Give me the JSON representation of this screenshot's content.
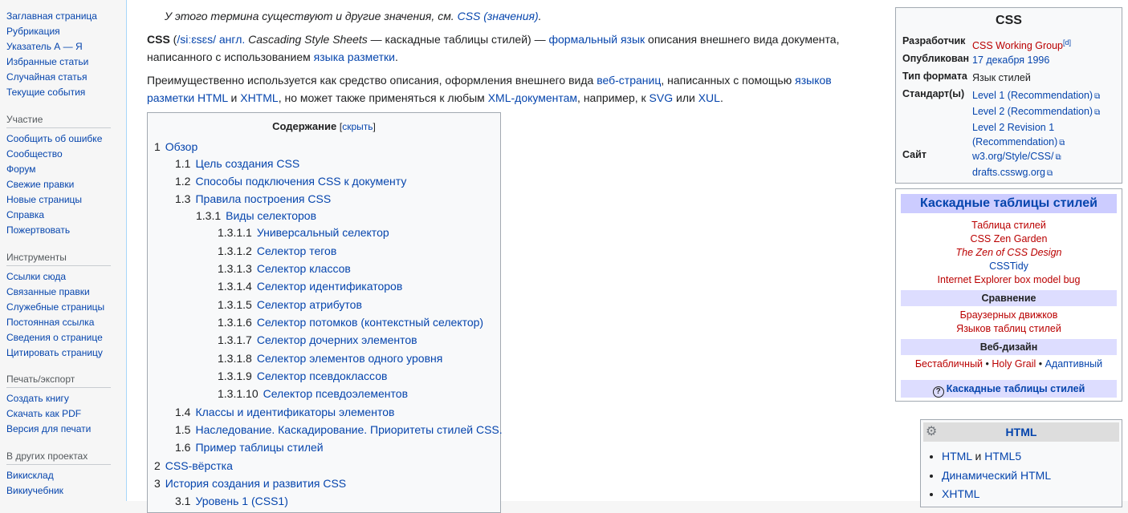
{
  "sidebar": {
    "main": [
      "Заглавная страница",
      "Рубрикация",
      "Указатель А — Я",
      "Избранные статьи",
      "Случайная статья",
      "Текущие события"
    ],
    "participation": {
      "heading": "Участие",
      "items": [
        "Сообщить об ошибке",
        "Сообщество",
        "Форум",
        "Свежие правки",
        "Новые страницы",
        "Справка",
        "Пожертвовать"
      ]
    },
    "tools": {
      "heading": "Инструменты",
      "items": [
        "Ссылки сюда",
        "Связанные правки",
        "Служебные страницы",
        "Постоянная ссылка",
        "Сведения о странице",
        "Цитировать страницу"
      ]
    },
    "print": {
      "heading": "Печать/экспорт",
      "items": [
        "Создать книгу",
        "Скачать как PDF",
        "Версия для печати"
      ]
    },
    "other": {
      "heading": "В других проектах",
      "items": [
        "Викисклад",
        "Викиучебник"
      ]
    }
  },
  "hatnote": {
    "text": "У этого термина существуют и другие значения, см. ",
    "link": "CSS (значения)",
    "end": "."
  },
  "lead1": {
    "bold": "CSS",
    "ipa": "/siːɛsɛs/",
    "lang": "англ.",
    "term": "Cascading Style Sheets",
    "dash": " — каскадные таблицы стилей) — ",
    "link1": "формальный язык",
    "mid": " описания внешнего вида документа, написанного с использованием ",
    "link2": "языка разметки",
    "end": "."
  },
  "lead2": {
    "t1": "Преимущественно используется как средство описания, оформления внешнего вида ",
    "l1": "веб-страниц",
    "t2": ", написанных с помощью ",
    "l2": "языков разметки HTML",
    "t3": " и ",
    "l3": "XHTML",
    "t4": ", но может также применяться к любым ",
    "l4": "XML-документам",
    "t5": ", например, к ",
    "l5": "SVG",
    "t6": " или ",
    "l6": "XUL",
    "t7": "."
  },
  "toc": {
    "title": "Содержание",
    "toggle_open": "[",
    "toggle_label": "скрыть",
    "toggle_close": "]",
    "items": [
      {
        "num": "1",
        "text": "Обзор"
      },
      {
        "num": "1.1",
        "text": "Цель создания CSS"
      },
      {
        "num": "1.2",
        "text": "Способы подключения CSS к документу"
      },
      {
        "num": "1.3",
        "text": "Правила построения CSS"
      },
      {
        "num": "1.3.1",
        "text": "Виды селекторов"
      },
      {
        "num": "1.3.1.1",
        "text": "Универсальный селектор"
      },
      {
        "num": "1.3.1.2",
        "text": "Селектор тегов"
      },
      {
        "num": "1.3.1.3",
        "text": "Селектор классов"
      },
      {
        "num": "1.3.1.4",
        "text": "Селектор идентификаторов"
      },
      {
        "num": "1.3.1.5",
        "text": "Селектор атрибутов"
      },
      {
        "num": "1.3.1.6",
        "text": "Селектор потомков (контекстный селектор)"
      },
      {
        "num": "1.3.1.7",
        "text": "Селектор дочерних элементов"
      },
      {
        "num": "1.3.1.8",
        "text": "Селектор элементов одного уровня"
      },
      {
        "num": "1.3.1.9",
        "text": "Селектор псевдоклассов"
      },
      {
        "num": "1.3.1.10",
        "text": "Селектор псевдоэлементов"
      },
      {
        "num": "1.4",
        "text": "Классы и идентификаторы элементов"
      },
      {
        "num": "1.5",
        "text": "Наследование. Каскадирование. Приоритеты стилей CSS."
      },
      {
        "num": "1.6",
        "text": "Пример таблицы стилей"
      },
      {
        "num": "2",
        "text": "CSS-вёрстка"
      },
      {
        "num": "3",
        "text": "История создания и развития CSS"
      },
      {
        "num": "3.1",
        "text": "Уровень 1 (CSS1)"
      }
    ]
  },
  "infobox": {
    "title": "CSS",
    "developer_label": "Разработчик",
    "developer": "CSS Working Group",
    "developer_sup": "[d]",
    "published_label": "Опубликован",
    "published": "17 декабря 1996",
    "format_label": "Тип формата",
    "format": "Язык стилей",
    "standard_label": "Стандарт(ы)",
    "standard1": "Level 1 (Recommendation)",
    "standard2": "Level 2 (Recommendation)",
    "standard3a": "Level 2 Revision 1",
    "standard3b": "(Recommendation)",
    "site_label": "Сайт",
    "site1": "w3.org/Style/CSS/",
    "site2": "drafts.csswg.org"
  },
  "navbox": {
    "title": "Каскадные таблицы стилей",
    "items": [
      "Таблица стилей",
      "CSS Zen Garden",
      "The Zen of CSS Design",
      "CSSTidy",
      "Internet Explorer box model bug"
    ],
    "group1": "Сравнение",
    "group1_items": [
      "Браузерных движков",
      "Языков таблиц стилей"
    ],
    "group2": "Веб-дизайн",
    "group2_items": [
      "Бестабличный",
      "Holy Grail",
      "Адаптивный"
    ],
    "sep": " • ",
    "footer": "Каскадные таблицы стилей",
    "help_glyph": "?"
  },
  "htmlbox": {
    "title": "HTML",
    "gear_glyph": "⚙",
    "row1a": "HTML",
    "row1b": " и ",
    "row1c": "HTML5",
    "row2": "Динамический HTML",
    "row3": "XHTML"
  },
  "icons": {
    "external": "⧉"
  }
}
